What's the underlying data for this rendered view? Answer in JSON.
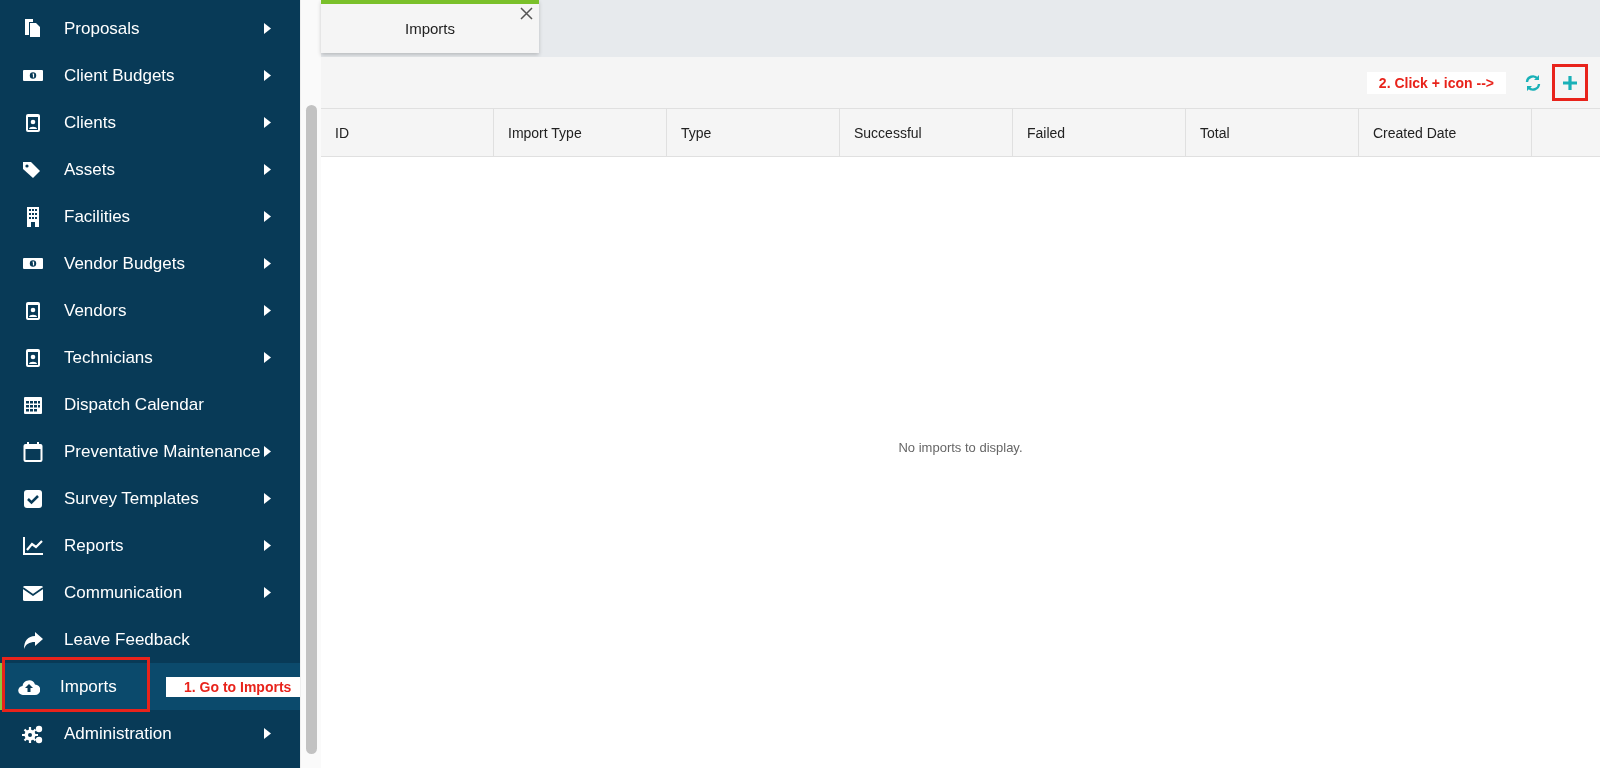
{
  "sidebar": {
    "items": [
      {
        "label": "Proposals",
        "has_submenu": true,
        "selected": false,
        "highlighted": false
      },
      {
        "label": "Client Budgets",
        "has_submenu": true,
        "selected": false,
        "highlighted": false
      },
      {
        "label": "Clients",
        "has_submenu": true,
        "selected": false,
        "highlighted": false
      },
      {
        "label": "Assets",
        "has_submenu": true,
        "selected": false,
        "highlighted": false
      },
      {
        "label": "Facilities",
        "has_submenu": true,
        "selected": false,
        "highlighted": false
      },
      {
        "label": "Vendor Budgets",
        "has_submenu": true,
        "selected": false,
        "highlighted": false
      },
      {
        "label": "Vendors",
        "has_submenu": true,
        "selected": false,
        "highlighted": false
      },
      {
        "label": "Technicians",
        "has_submenu": true,
        "selected": false,
        "highlighted": false
      },
      {
        "label": "Dispatch Calendar",
        "has_submenu": false,
        "selected": false,
        "highlighted": false
      },
      {
        "label": "Preventative Maintenance",
        "has_submenu": true,
        "selected": false,
        "highlighted": false
      },
      {
        "label": "Survey Templates",
        "has_submenu": true,
        "selected": false,
        "highlighted": false
      },
      {
        "label": "Reports",
        "has_submenu": true,
        "selected": false,
        "highlighted": false
      },
      {
        "label": "Communication",
        "has_submenu": true,
        "selected": false,
        "highlighted": false
      },
      {
        "label": "Leave Feedback",
        "has_submenu": false,
        "selected": false,
        "highlighted": false
      },
      {
        "label": "Imports",
        "has_submenu": false,
        "selected": true,
        "highlighted": true,
        "callout": "1. Go to Imports"
      },
      {
        "label": "Administration",
        "has_submenu": true,
        "selected": false,
        "highlighted": false
      }
    ]
  },
  "tabs": [
    {
      "label": "Imports",
      "selected": true
    }
  ],
  "toolbar": {
    "callout": "2. Click + icon -->",
    "add_highlighted": true
  },
  "table": {
    "columns": [
      "ID",
      "Import Type",
      "Type",
      "Successful",
      "Failed",
      "Total",
      "Created Date"
    ],
    "empty_text": "No imports to display."
  }
}
